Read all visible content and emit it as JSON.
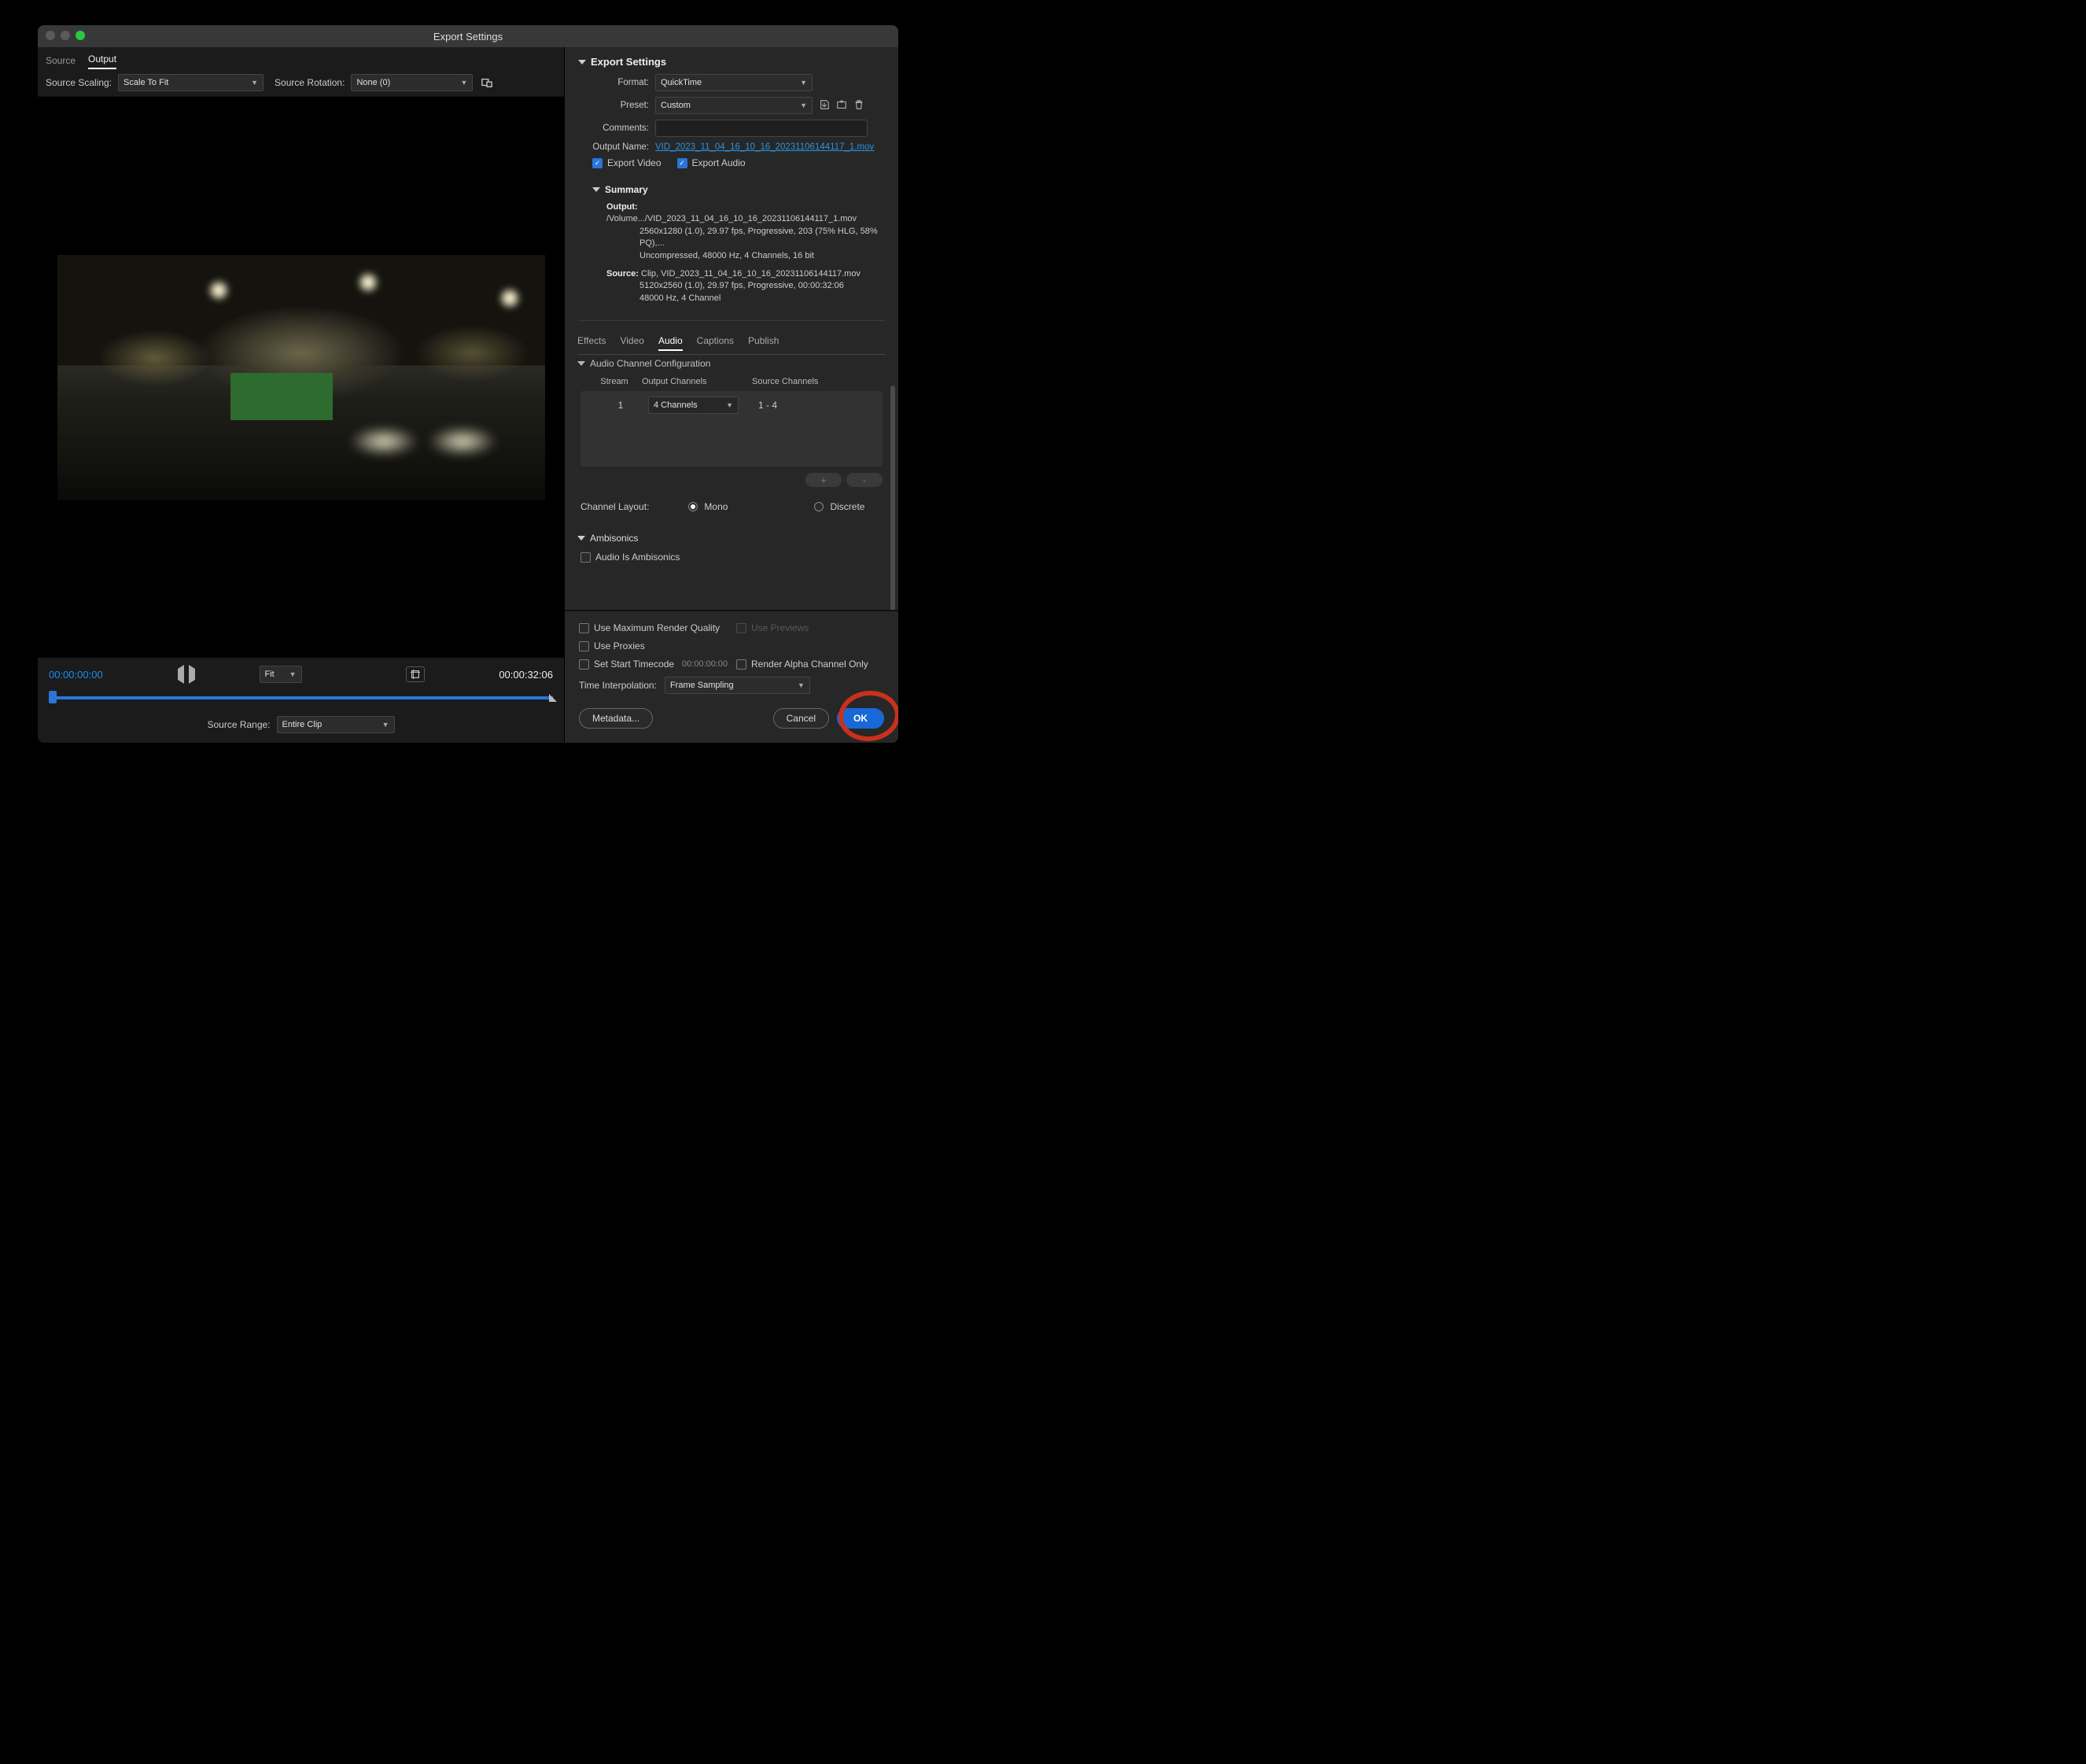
{
  "window_title": "Export Settings",
  "left": {
    "tabs": {
      "source": "Source",
      "output": "Output"
    },
    "source_scaling": {
      "label": "Source Scaling:",
      "value": "Scale To Fit"
    },
    "source_rotation": {
      "label": "Source Rotation:",
      "value": "None (0)"
    },
    "tc_start": "00:00:00:00",
    "tc_end": "00:00:32:06",
    "zoom_value": "Fit",
    "source_range": {
      "label": "Source Range:",
      "value": "Entire Clip"
    }
  },
  "export": {
    "header": "Export Settings",
    "format": {
      "label": "Format:",
      "value": "QuickTime"
    },
    "preset": {
      "label": "Preset:",
      "value": "Custom"
    },
    "comments_label": "Comments:",
    "output_name": {
      "label": "Output Name:",
      "value": "VID_2023_11_04_16_10_16_20231106144117_1.mov"
    },
    "export_video": "Export Video",
    "export_audio": "Export Audio",
    "summary": {
      "header": "Summary",
      "output_label": "Output:",
      "output_line1": "/Volume.../VID_2023_11_04_16_10_16_20231106144117_1.mov",
      "output_line2": "2560x1280 (1.0), 29.97 fps, Progressive, 203 (75% HLG, 58% PQ),...",
      "output_line3": "Uncompressed, 48000 Hz, 4 Channels, 16 bit",
      "source_label": "Source:",
      "source_line1": "Clip, VID_2023_11_04_16_10_16_20231106144117.mov",
      "source_line2": "5120x2560 (1.0), 29.97 fps, Progressive, 00:00:32:06",
      "source_line3": "48000 Hz, 4 Channel"
    }
  },
  "tabs2": {
    "effects": "Effects",
    "video": "Video",
    "audio": "Audio",
    "captions": "Captions",
    "publish": "Publish"
  },
  "audio": {
    "config_header": "Audio Channel Configuration",
    "col_stream": "Stream",
    "col_output": "Output Channels",
    "col_source": "Source Channels",
    "stream_num": "1",
    "output_channels": "4 Channels",
    "source_channels": "1 - 4",
    "plus": "+",
    "minus": "-",
    "channel_layout_label": "Channel Layout:",
    "mono": "Mono",
    "discrete": "Discrete",
    "ambisonics_header": "Ambisonics",
    "ambisonics_check": "Audio Is Ambisonics"
  },
  "bottom": {
    "max_render": "Use Maximum Render Quality",
    "use_previews": "Use Previews",
    "use_proxies": "Use Proxies",
    "set_start_tc": "Set Start Timecode",
    "start_tc_val": "00:00:00:00",
    "render_alpha": "Render Alpha Channel Only",
    "time_interp_label": "Time Interpolation:",
    "time_interp_value": "Frame Sampling",
    "metadata_btn": "Metadata...",
    "cancel_btn": "Cancel",
    "ok_btn": "OK"
  }
}
